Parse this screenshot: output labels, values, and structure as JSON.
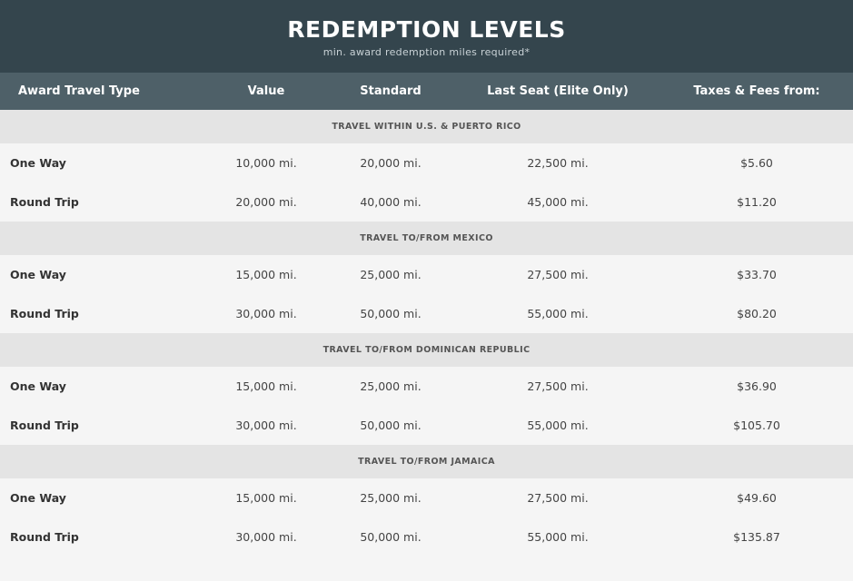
{
  "header": {
    "title": "REDEMPTION LEVELS",
    "subtitle": "min. award redemption miles required*"
  },
  "columns": [
    "Award Travel Type",
    "Value",
    "Standard",
    "Last Seat (Elite Only)",
    "Taxes & Fees from:"
  ],
  "sections": [
    {
      "title": "TRAVEL WITHIN U.S. & PUERTO RICO",
      "rows": [
        {
          "type": "One Way",
          "value": "10,000 mi.",
          "standard": "20,000 mi.",
          "last_seat": "22,500 mi.",
          "taxes": "$5.60"
        },
        {
          "type": "Round Trip",
          "value": "20,000 mi.",
          "standard": "40,000 mi.",
          "last_seat": "45,000 mi.",
          "taxes": "$11.20"
        }
      ]
    },
    {
      "title": "TRAVEL TO/FROM MEXICO",
      "rows": [
        {
          "type": "One Way",
          "value": "15,000 mi.",
          "standard": "25,000 mi.",
          "last_seat": "27,500 mi.",
          "taxes": "$33.70"
        },
        {
          "type": "Round Trip",
          "value": "30,000 mi.",
          "standard": "50,000 mi.",
          "last_seat": "55,000 mi.",
          "taxes": "$80.20"
        }
      ]
    },
    {
      "title": "TRAVEL TO/FROM DOMINICAN REPUBLIC",
      "rows": [
        {
          "type": "One Way",
          "value": "15,000 mi.",
          "standard": "25,000 mi.",
          "last_seat": "27,500 mi.",
          "taxes": "$36.90"
        },
        {
          "type": "Round Trip",
          "value": "30,000 mi.",
          "standard": "50,000 mi.",
          "last_seat": "55,000 mi.",
          "taxes": "$105.70"
        }
      ]
    },
    {
      "title": "TRAVEL TO/FROM JAMAICA",
      "rows": [
        {
          "type": "One Way",
          "value": "15,000 mi.",
          "standard": "25,000 mi.",
          "last_seat": "27,500 mi.",
          "taxes": "$49.60"
        },
        {
          "type": "Round Trip",
          "value": "30,000 mi.",
          "standard": "50,000 mi.",
          "last_seat": "55,000 mi.",
          "taxes": "$135.87"
        }
      ]
    }
  ]
}
